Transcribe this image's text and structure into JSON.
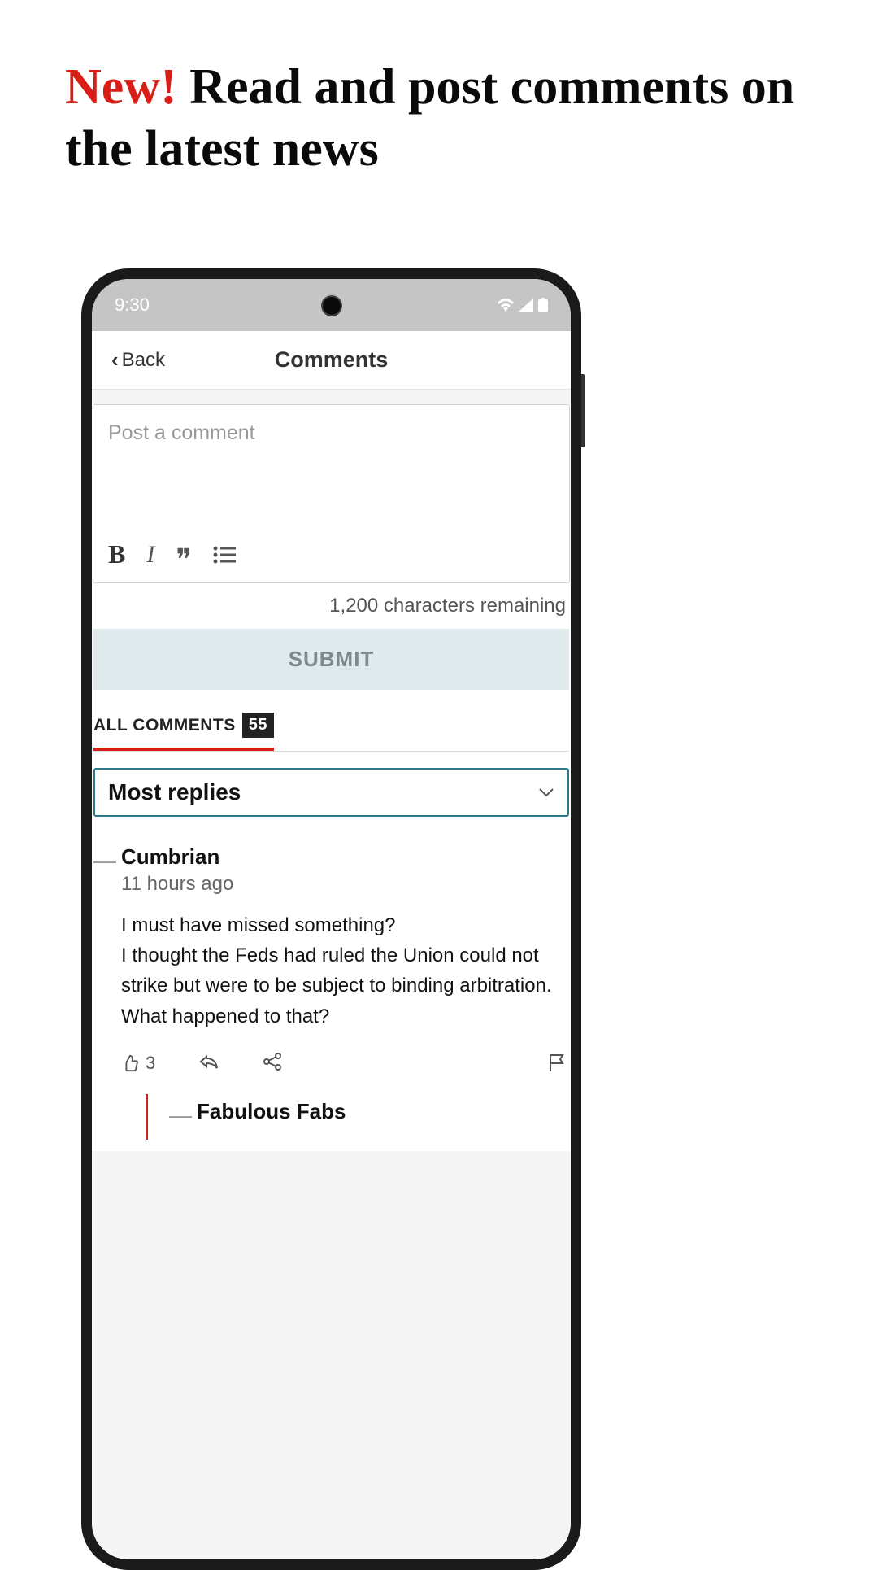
{
  "headline": {
    "accent": "New!",
    "rest": " Read and post comments on the latest news"
  },
  "statusBar": {
    "time": "9:30"
  },
  "nav": {
    "back": "Back",
    "title": "Comments"
  },
  "composer": {
    "placeholder": "Post a comment",
    "remaining": "1,200 characters remaining",
    "submit": "SUBMIT"
  },
  "tabs": {
    "allLabel": "ALL COMMENTS",
    "count": "55"
  },
  "sort": {
    "selected": "Most replies"
  },
  "comments": [
    {
      "author": "Cumbrian",
      "time": "11 hours ago",
      "text": "I must have missed something?\nI thought the Feds had ruled the Union could not strike but were to be subject to binding arbitration. What happened to that?",
      "likes": "3",
      "replies": [
        {
          "author": "Fabulous Fabs"
        }
      ]
    }
  ]
}
